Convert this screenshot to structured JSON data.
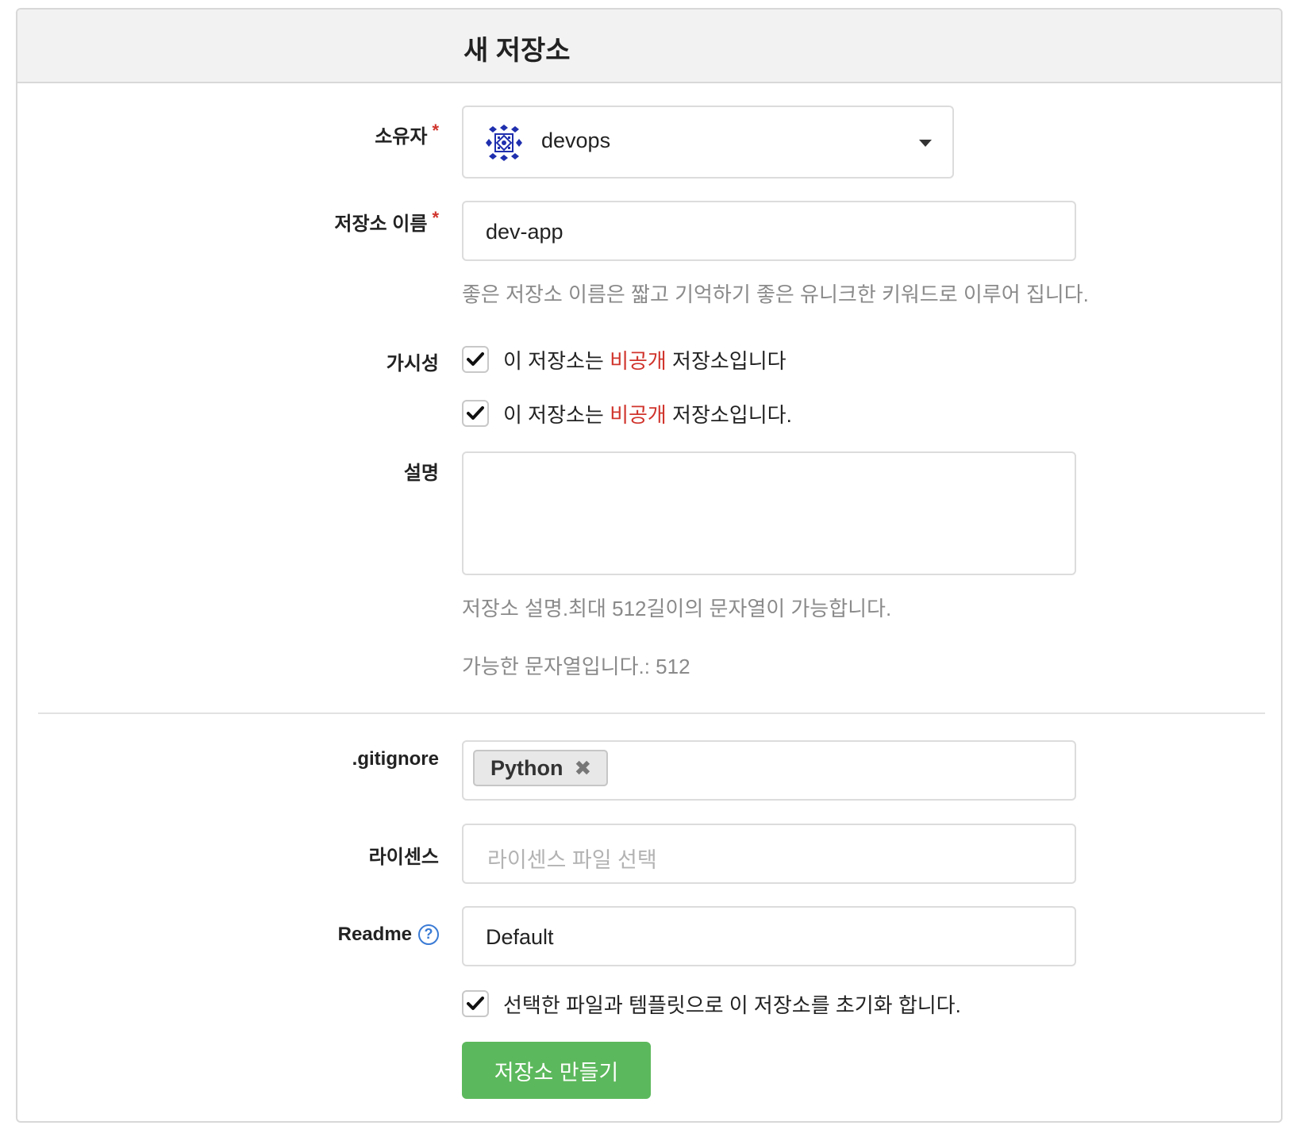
{
  "page_title": "새 저장소",
  "required_mark": "*",
  "owner": {
    "label": "소유자",
    "value": "devops"
  },
  "repo_name": {
    "label": "저장소 이름",
    "value": "dev-app",
    "help": "좋은 저장소 이름은 짧고 기억하기 좋은 유니크한 키워드로 이루어 집니다."
  },
  "visibility": {
    "label": "가시성",
    "options": [
      {
        "prefix": "이 저장소는 ",
        "highlight": "비공개",
        "suffix": " 저장소입니다",
        "checked": true
      },
      {
        "prefix": "이 저장소는 ",
        "highlight": "비공개",
        "suffix": " 저장소입니다.",
        "checked": true
      }
    ]
  },
  "description": {
    "label": "설명",
    "help": "저장소 설명.최대 512길이의 문자열이 가능합니다.",
    "remaining": "가능한 문자열입니다.: 512"
  },
  "gitignore": {
    "label": ".gitignore",
    "tag": "Python",
    "remove_glyph": "✖"
  },
  "license": {
    "label": "라이센스",
    "placeholder": "라이센스 파일 선택"
  },
  "readme": {
    "label": "Readme",
    "help_glyph": "?",
    "value": "Default"
  },
  "init": {
    "label": "선택한 파일과 템플릿으로 이 저장소를 초기화 합니다.",
    "checked": true
  },
  "submit": {
    "label": "저장소 만들기"
  },
  "colors": {
    "accent_green": "#5cb85c",
    "required_red": "#d0342c",
    "help_blue": "#3a7bd5"
  }
}
